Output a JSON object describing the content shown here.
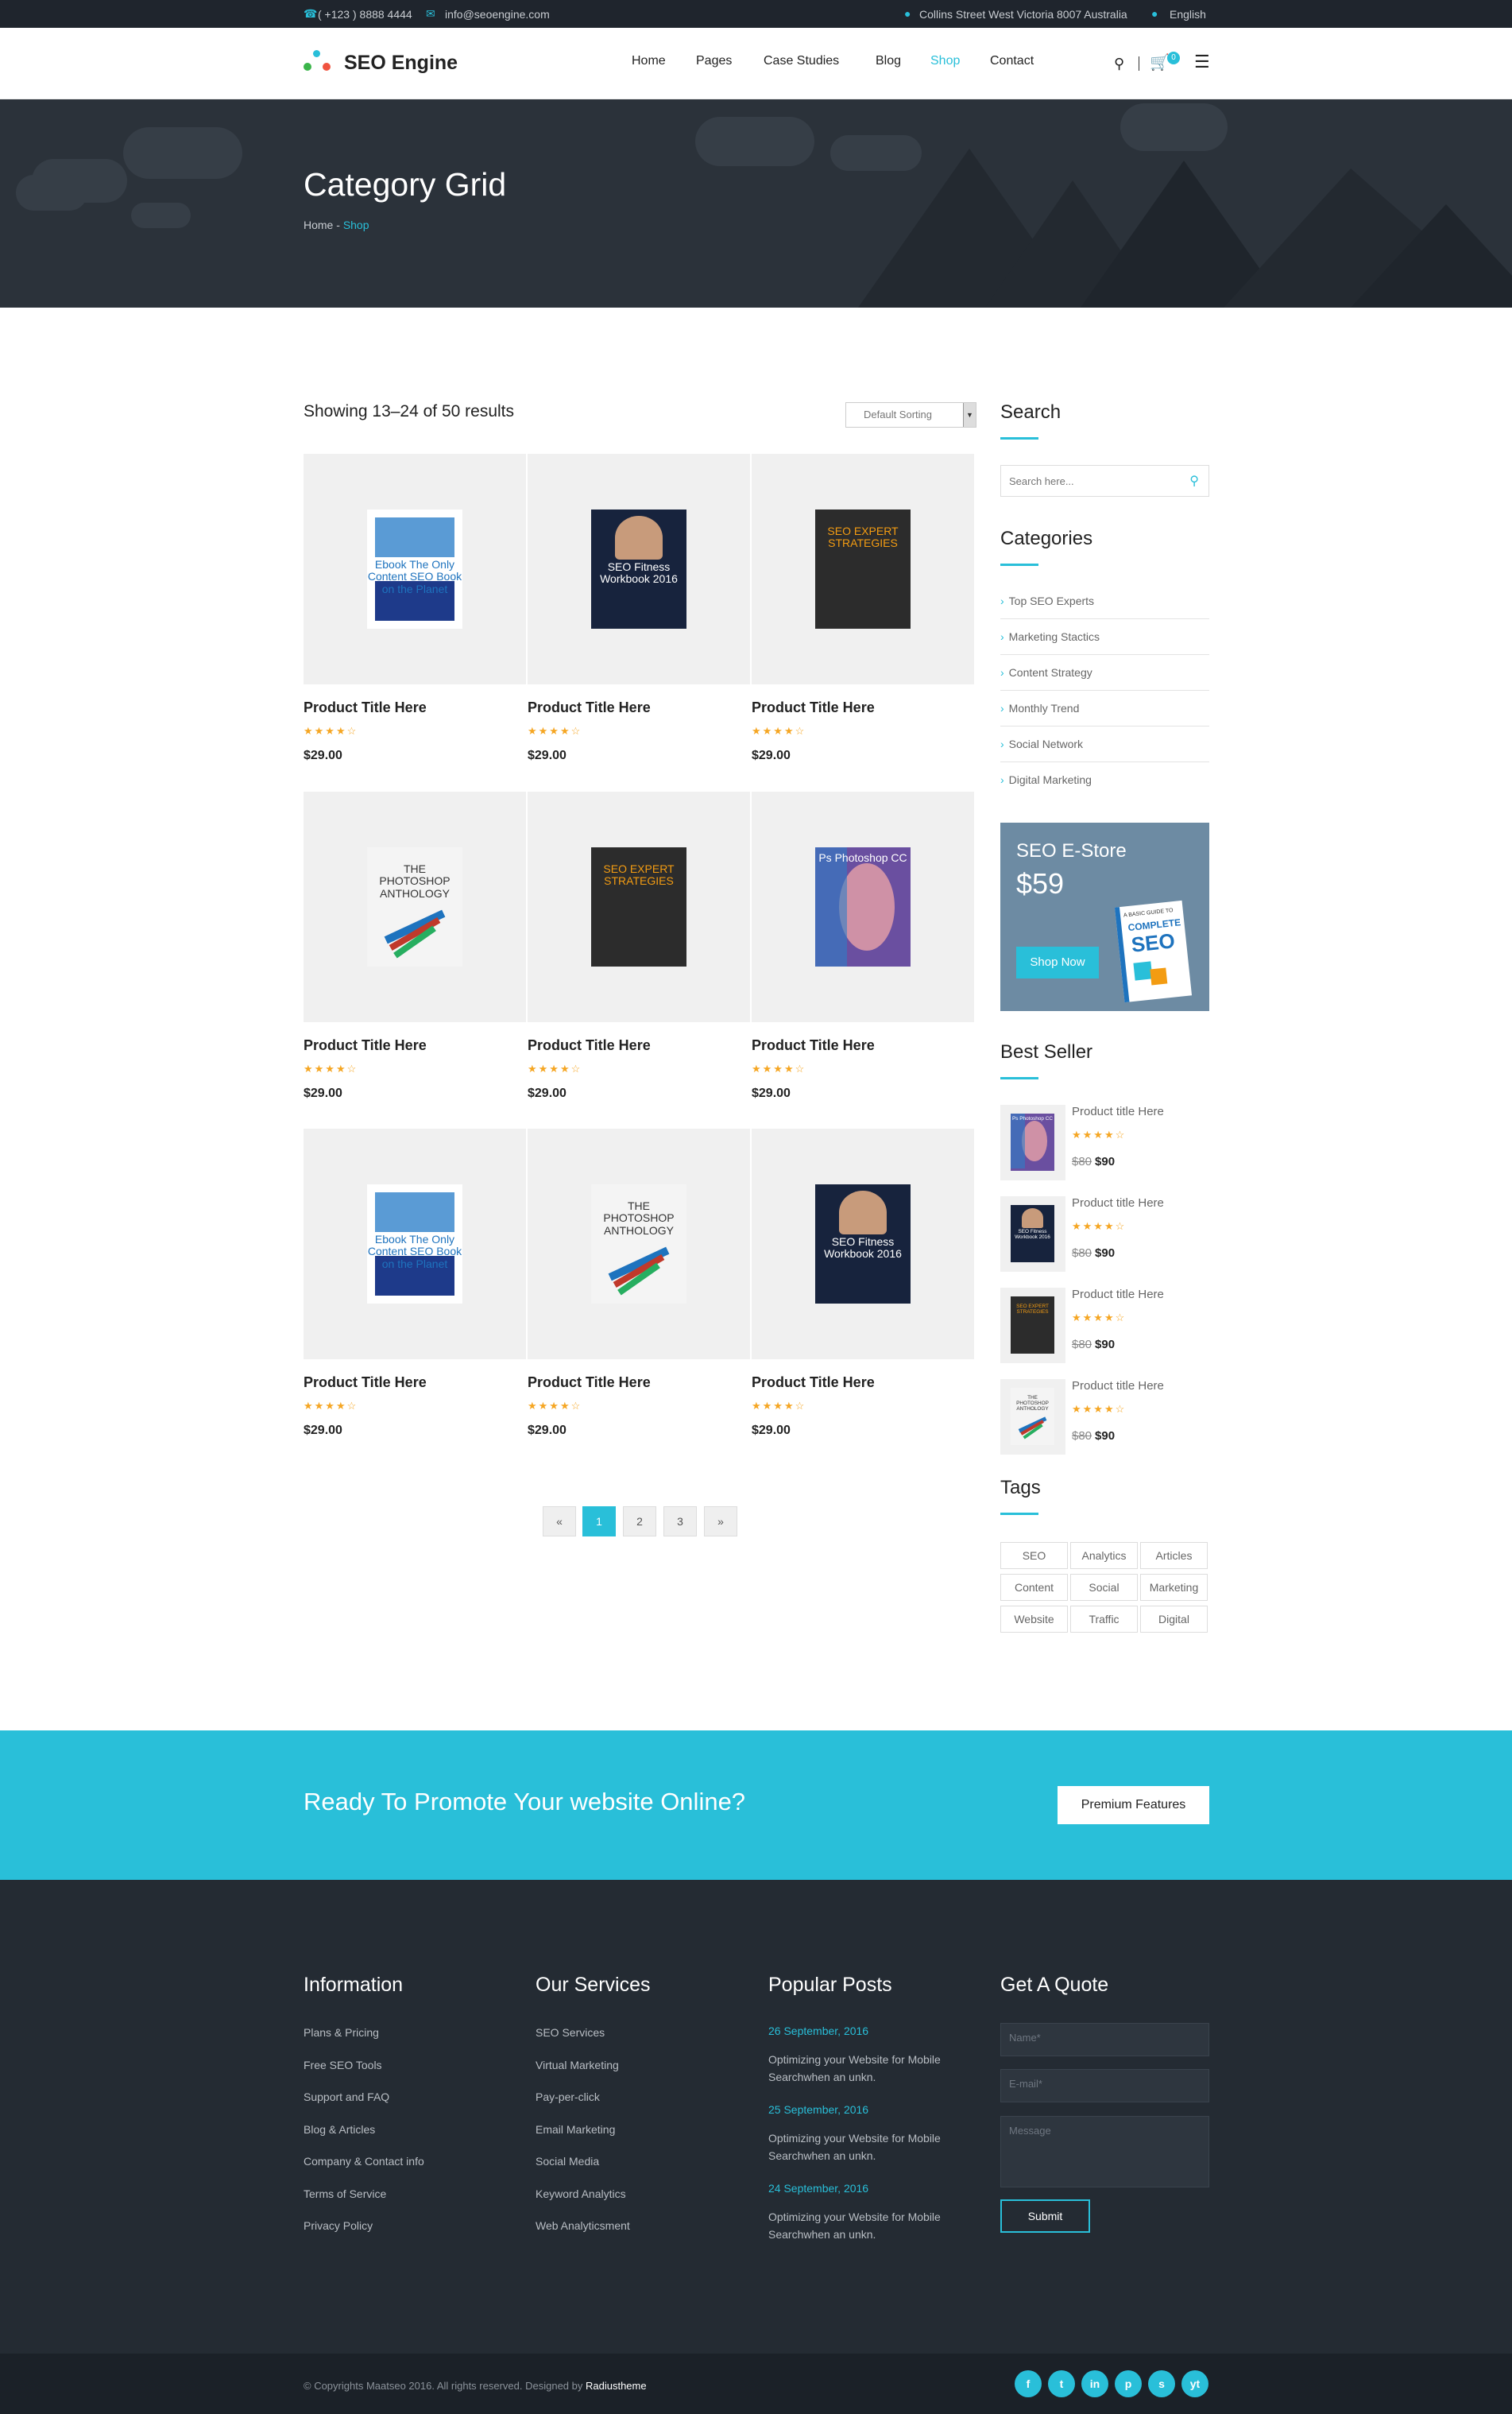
{
  "topbar": {
    "phone": "( +123 ) 8888 4444",
    "email": "info@seoengine.com",
    "address": "Collins Street West Victoria 8007 Australia",
    "language": "English"
  },
  "header": {
    "logo": "SEO Engine",
    "nav": [
      "Home",
      "Pages",
      "Case Studies",
      "Blog",
      "Shop",
      "Contact"
    ],
    "active_nav": "Shop",
    "cart_count": "0"
  },
  "hero": {
    "title": "Category Grid",
    "crumb_home": "Home",
    "crumb_sep": " - ",
    "crumb_current": "Shop"
  },
  "shop": {
    "results": "Showing 13–24 of 50 results",
    "sorting": "Default Sorting",
    "products": [
      {
        "title": "Product Title Here",
        "price": "$29.00",
        "rating": 4,
        "cover": "ebook"
      },
      {
        "title": "Product Title Here",
        "price": "$29.00",
        "rating": 4,
        "cover": "seo-fitness"
      },
      {
        "title": "Product Title Here",
        "price": "$29.00",
        "rating": 4,
        "cover": "seo-expert"
      },
      {
        "title": "Product Title Here",
        "price": "$29.00",
        "rating": 4,
        "cover": "photoshop-anthology"
      },
      {
        "title": "Product Title Here",
        "price": "$29.00",
        "rating": 4,
        "cover": "seo-expert"
      },
      {
        "title": "Product Title Here",
        "price": "$29.00",
        "rating": 4,
        "cover": "photoshop-cc"
      },
      {
        "title": "Product Title Here",
        "price": "$29.00",
        "rating": 4,
        "cover": "ebook"
      },
      {
        "title": "Product Title Here",
        "price": "$29.00",
        "rating": 4,
        "cover": "photoshop-anthology"
      },
      {
        "title": "Product Title Here",
        "price": "$29.00",
        "rating": 4,
        "cover": "seo-fitness"
      }
    ],
    "pagination": [
      "«",
      "1",
      "2",
      "3",
      "»"
    ],
    "current_page": "1"
  },
  "covers": {
    "ebook": {
      "lines": [
        "Ebook",
        "The Only Content SEO Book on the Planet"
      ]
    },
    "seo_fitness": {
      "lines": [
        "SEO",
        "Fitness",
        "Workbook",
        "2016"
      ]
    },
    "seo_expert": {
      "lines": [
        "SEO",
        "EXPERT",
        "STRATEGIES"
      ]
    },
    "photoshop_anthology": {
      "lines": [
        "THE",
        "PHOTOSHOP",
        "ANTHOLOGY"
      ]
    },
    "photoshop_cc": {
      "lines": [
        "Ps",
        "Photoshop CC"
      ]
    }
  },
  "sidebar": {
    "search_title": "Search",
    "search_placeholder": "Search here...",
    "categories_title": "Categories",
    "categories": [
      "Top SEO Experts",
      "Marketing Stactics",
      "Content Strategy",
      "Monthly Trend",
      "Social Network",
      "Digital Marketing"
    ],
    "promo": {
      "title": "SEO E-Store",
      "price": "$59",
      "button": "Shop Now",
      "book_line1": "A BASIC GUIDE TO",
      "book_line2": "COMPLETE",
      "book_line3": "SEO"
    },
    "bestseller_title": "Best Seller",
    "bestsellers": [
      {
        "title": "Product title Here",
        "old": "$80",
        "new": "$90",
        "rating": 4,
        "cover": "photoshop-cc"
      },
      {
        "title": "Product title Here",
        "old": "$80",
        "new": "$90",
        "rating": 4,
        "cover": "seo-fitness"
      },
      {
        "title": "Product title Here",
        "old": "$80",
        "new": "$90",
        "rating": 4,
        "cover": "seo-expert"
      },
      {
        "title": "Product title Here",
        "old": "$80",
        "new": "$90",
        "rating": 4,
        "cover": "photoshop-anthology"
      }
    ],
    "tags_title": "Tags",
    "tags": [
      "SEO",
      "Analytics",
      "Articles",
      "Content",
      "Social",
      "Marketing",
      "Website",
      "Traffic",
      "Digital"
    ]
  },
  "cta": {
    "text": "Ready To Promote Your website Online?",
    "button": "Premium Features"
  },
  "footer": {
    "information_title": "Information",
    "information": [
      "Plans & Pricing",
      "Free SEO Tools",
      "Support and FAQ",
      "Blog & Articles",
      "Company & Contact info",
      "Terms of Service",
      "Privacy Policy"
    ],
    "services_title": "Our Services",
    "services": [
      "SEO Services",
      "Virtual Marketing",
      "Pay-per-click",
      "Email Marketing",
      "Social Media",
      "Keyword Analytics",
      "Web Analyticsment"
    ],
    "posts_title": "Popular Posts",
    "posts": [
      {
        "date": "26 September, 2016",
        "text": "Optimizing your Website for Mobile Searchwhen an unkn."
      },
      {
        "date": "25 September, 2016",
        "text": "Optimizing your Website for Mobile Searchwhen an unkn."
      },
      {
        "date": "24 September, 2016",
        "text": "Optimizing your Website for Mobile Searchwhen an unkn."
      }
    ],
    "quote_title": "Get A Quote",
    "name_ph": "Name*",
    "email_ph": "E-mail*",
    "message_ph": "Message",
    "submit": "Submit",
    "copyright": "© Copyrights Maatseo 2016. All rights reserved. Designed by ",
    "designer": "Radiustheme",
    "social": [
      "f",
      "t",
      "in",
      "p",
      "s",
      "yt"
    ]
  },
  "colors": {
    "accent": "#29bfd9",
    "dark": "#242b33",
    "hero": "#2b323a",
    "star": "#f5a623",
    "promo": "#6d8ba3"
  }
}
